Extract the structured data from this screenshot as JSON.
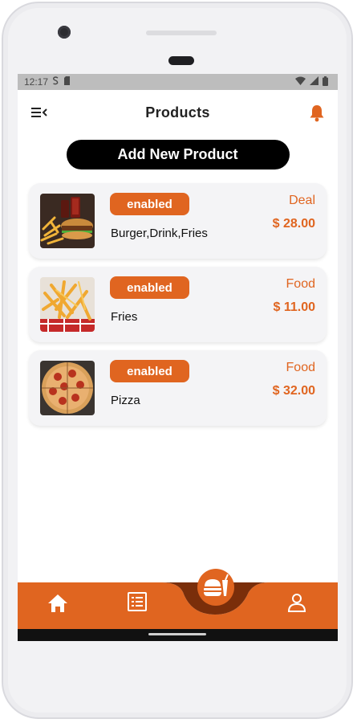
{
  "status_bar": {
    "time": "12:17"
  },
  "header": {
    "title": "Products"
  },
  "add_button_label": "Add New Product",
  "accent_color": "#e06520",
  "products": [
    {
      "status": "enabled",
      "name": "Burger,Drink,Fries",
      "category": "Deal",
      "price": "$ 28.00",
      "image": "combo-meal-image"
    },
    {
      "status": "enabled",
      "name": "Fries",
      "category": "Food",
      "price": "$ 11.00",
      "image": "fries-image"
    },
    {
      "status": "enabled",
      "name": "Pizza",
      "category": "Food",
      "price": "$ 32.00",
      "image": "pizza-image"
    }
  ],
  "bottom_nav": {
    "items": [
      "home-icon",
      "list-icon",
      "food-icon",
      "profile-icon"
    ],
    "active": "food-icon"
  }
}
